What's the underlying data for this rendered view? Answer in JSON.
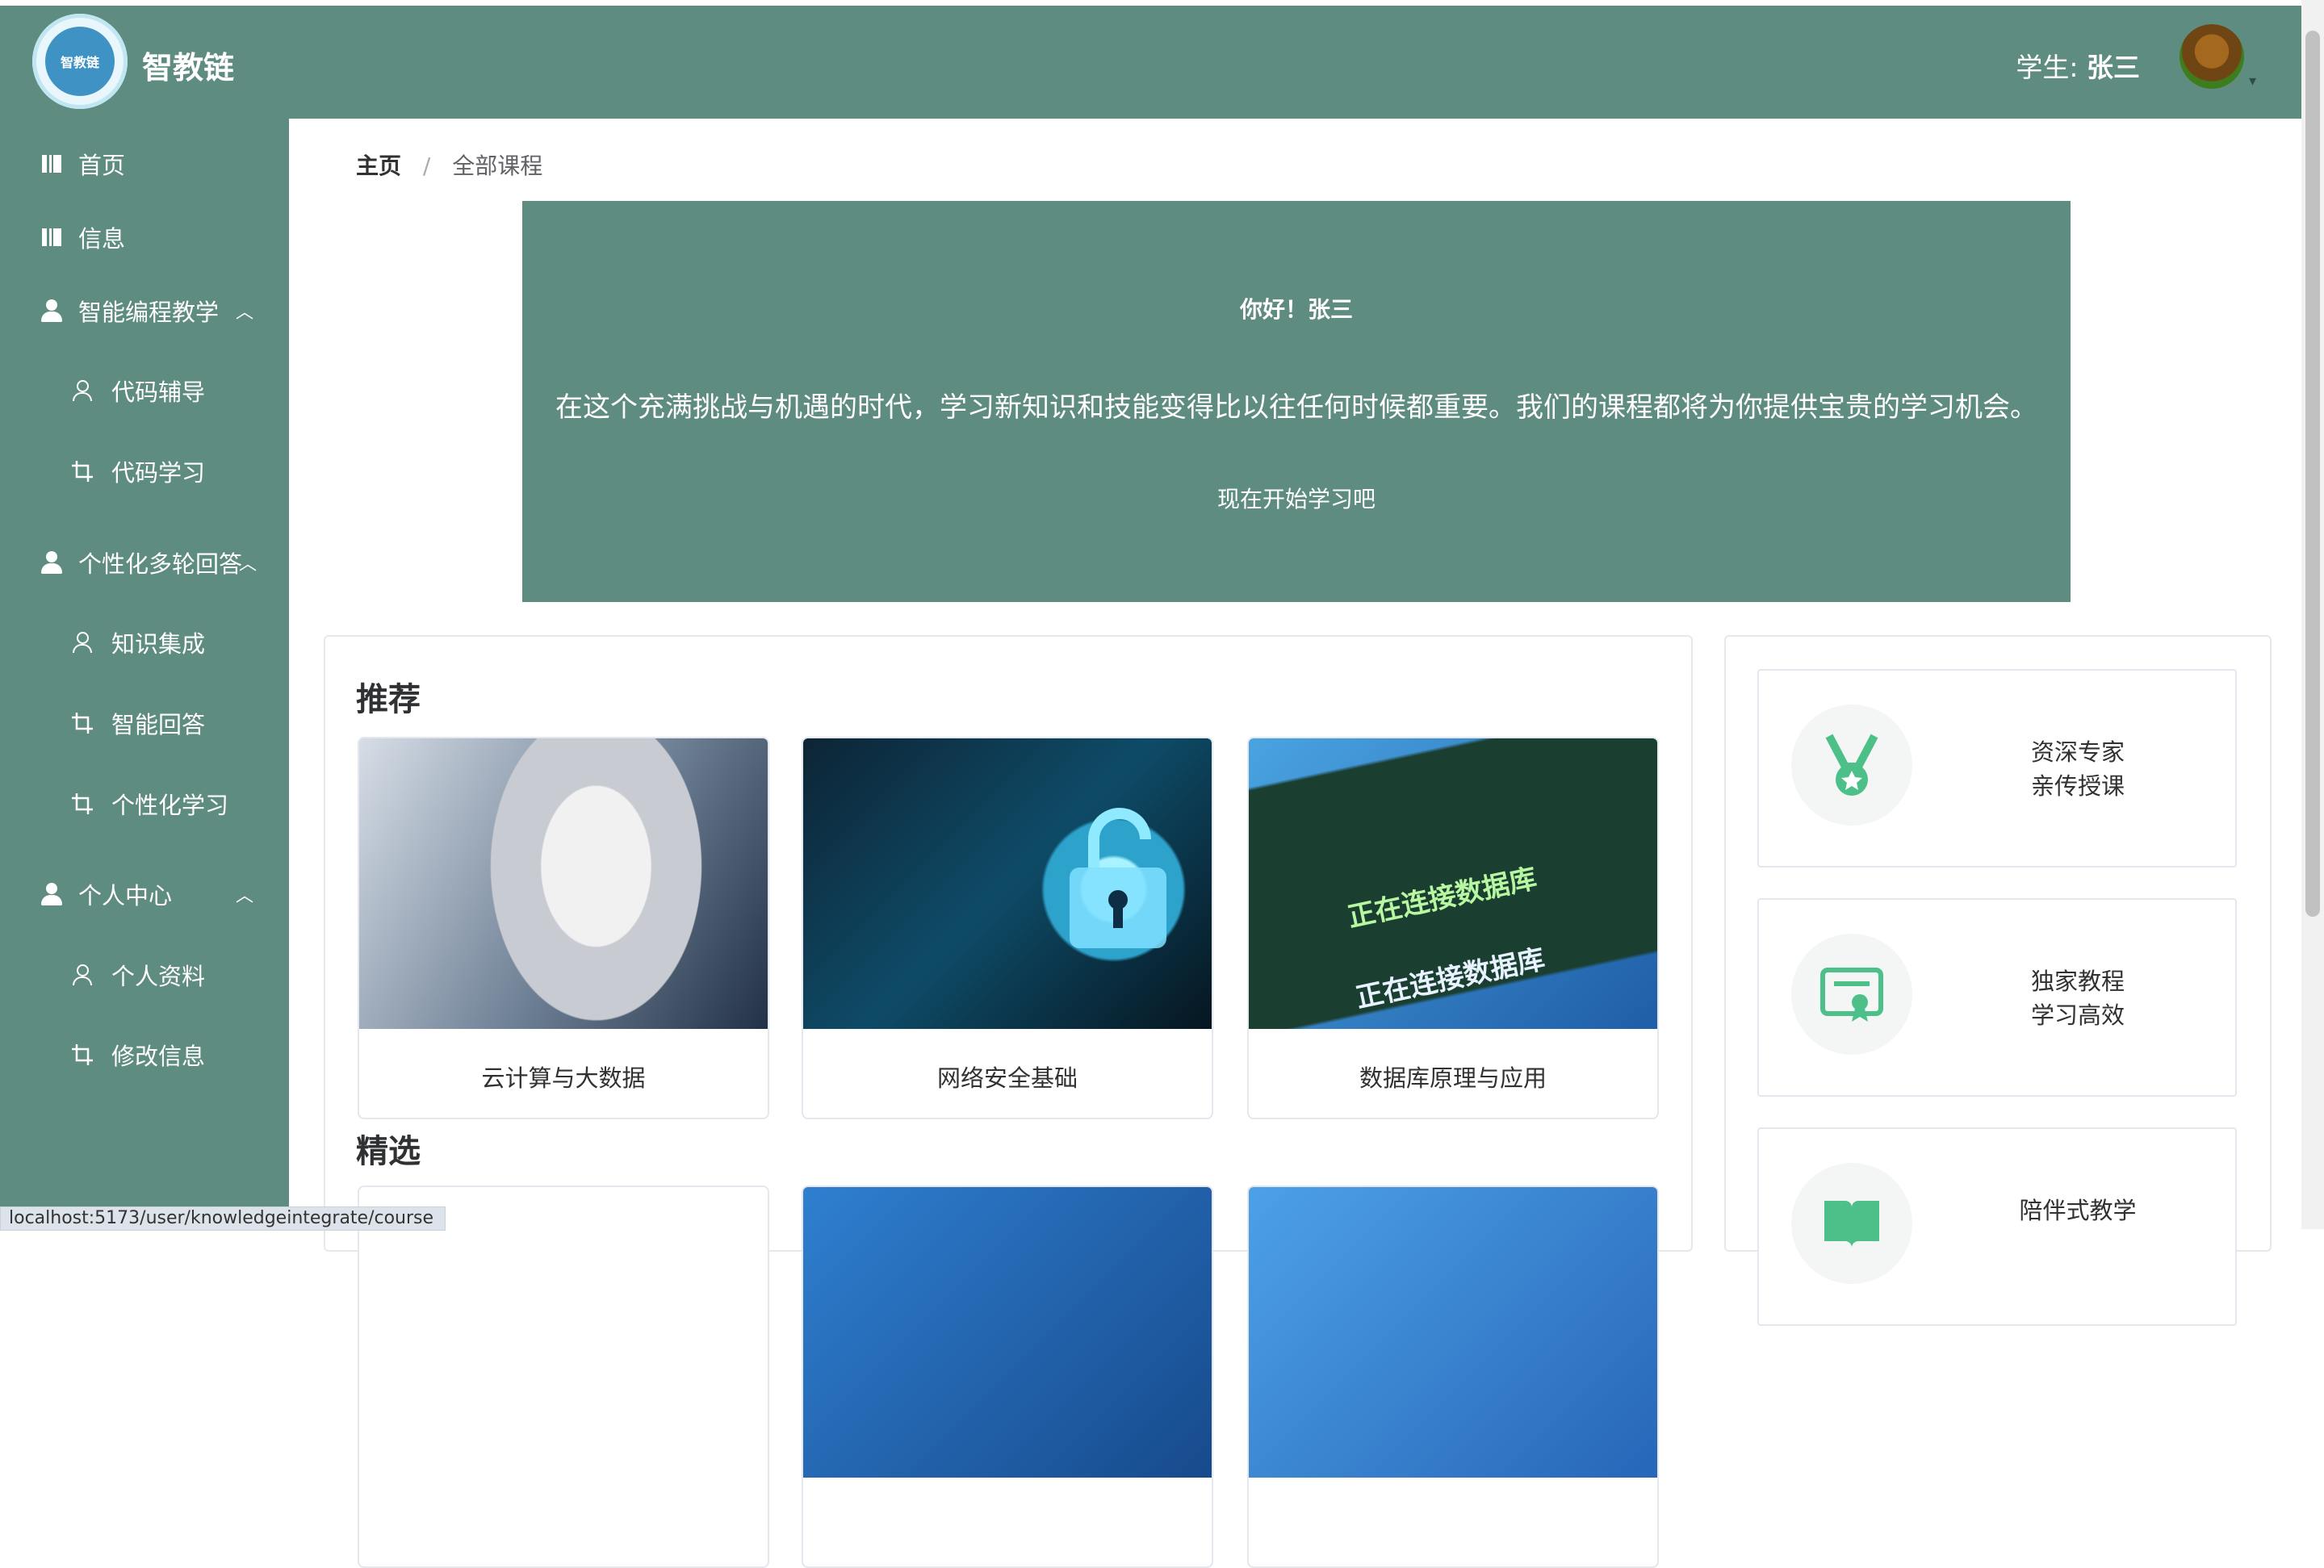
{
  "header": {
    "app_title": "智教链",
    "logo_text": "智教链",
    "user_role": "学生:",
    "user_name": "张三"
  },
  "sidebar": {
    "items": [
      {
        "label": "首页",
        "icon": "book-icon"
      },
      {
        "label": "信息",
        "icon": "book-icon"
      },
      {
        "label": "智能编程教学",
        "icon": "person-icon",
        "expanded": true
      },
      {
        "label": "代码辅导",
        "icon": "user-outline-icon"
      },
      {
        "label": "代码学习",
        "icon": "crop-icon"
      },
      {
        "label": "个性化多轮回答",
        "icon": "person-icon",
        "expanded": true
      },
      {
        "label": "知识集成",
        "icon": "user-outline-icon"
      },
      {
        "label": "智能回答",
        "icon": "crop-icon"
      },
      {
        "label": "个性化学习",
        "icon": "crop-icon"
      },
      {
        "label": "个人中心",
        "icon": "person-icon",
        "expanded": true
      },
      {
        "label": "个人资料",
        "icon": "user-outline-icon"
      },
      {
        "label": "修改信息",
        "icon": "crop-icon"
      }
    ]
  },
  "breadcrumb": {
    "home": "主页",
    "separator": "/",
    "current": "全部课程"
  },
  "banner": {
    "greeting": "你好！张三",
    "text": "在这个充满挑战与机遇的时代，学习新知识和技能变得比以往任何时候都重要。我们的课程都将为你提供宝贵的学习机会。",
    "cta": "现在开始学习吧"
  },
  "sections": {
    "recommended_title": "推荐",
    "featured_title": "精选"
  },
  "courses": {
    "recommended": [
      {
        "title": "云计算与大数据"
      },
      {
        "title": "网络安全基础"
      },
      {
        "title": "数据库原理与应用",
        "image_text": "正在连接数据库"
      }
    ]
  },
  "features": [
    {
      "line1": "资深专家",
      "line2": "亲传授课",
      "icon": "medal-icon"
    },
    {
      "line1": "独家教程",
      "line2": "学习高效",
      "icon": "certificate-icon"
    },
    {
      "line1": "陪伴式教学",
      "line2": "",
      "icon": "book-open-icon"
    }
  ],
  "status_bar": {
    "url": "localhost:5173/user/knowledgeintegrate/course"
  },
  "colors": {
    "primary": "#5f8c80",
    "accent_green": "#4dc08a"
  }
}
